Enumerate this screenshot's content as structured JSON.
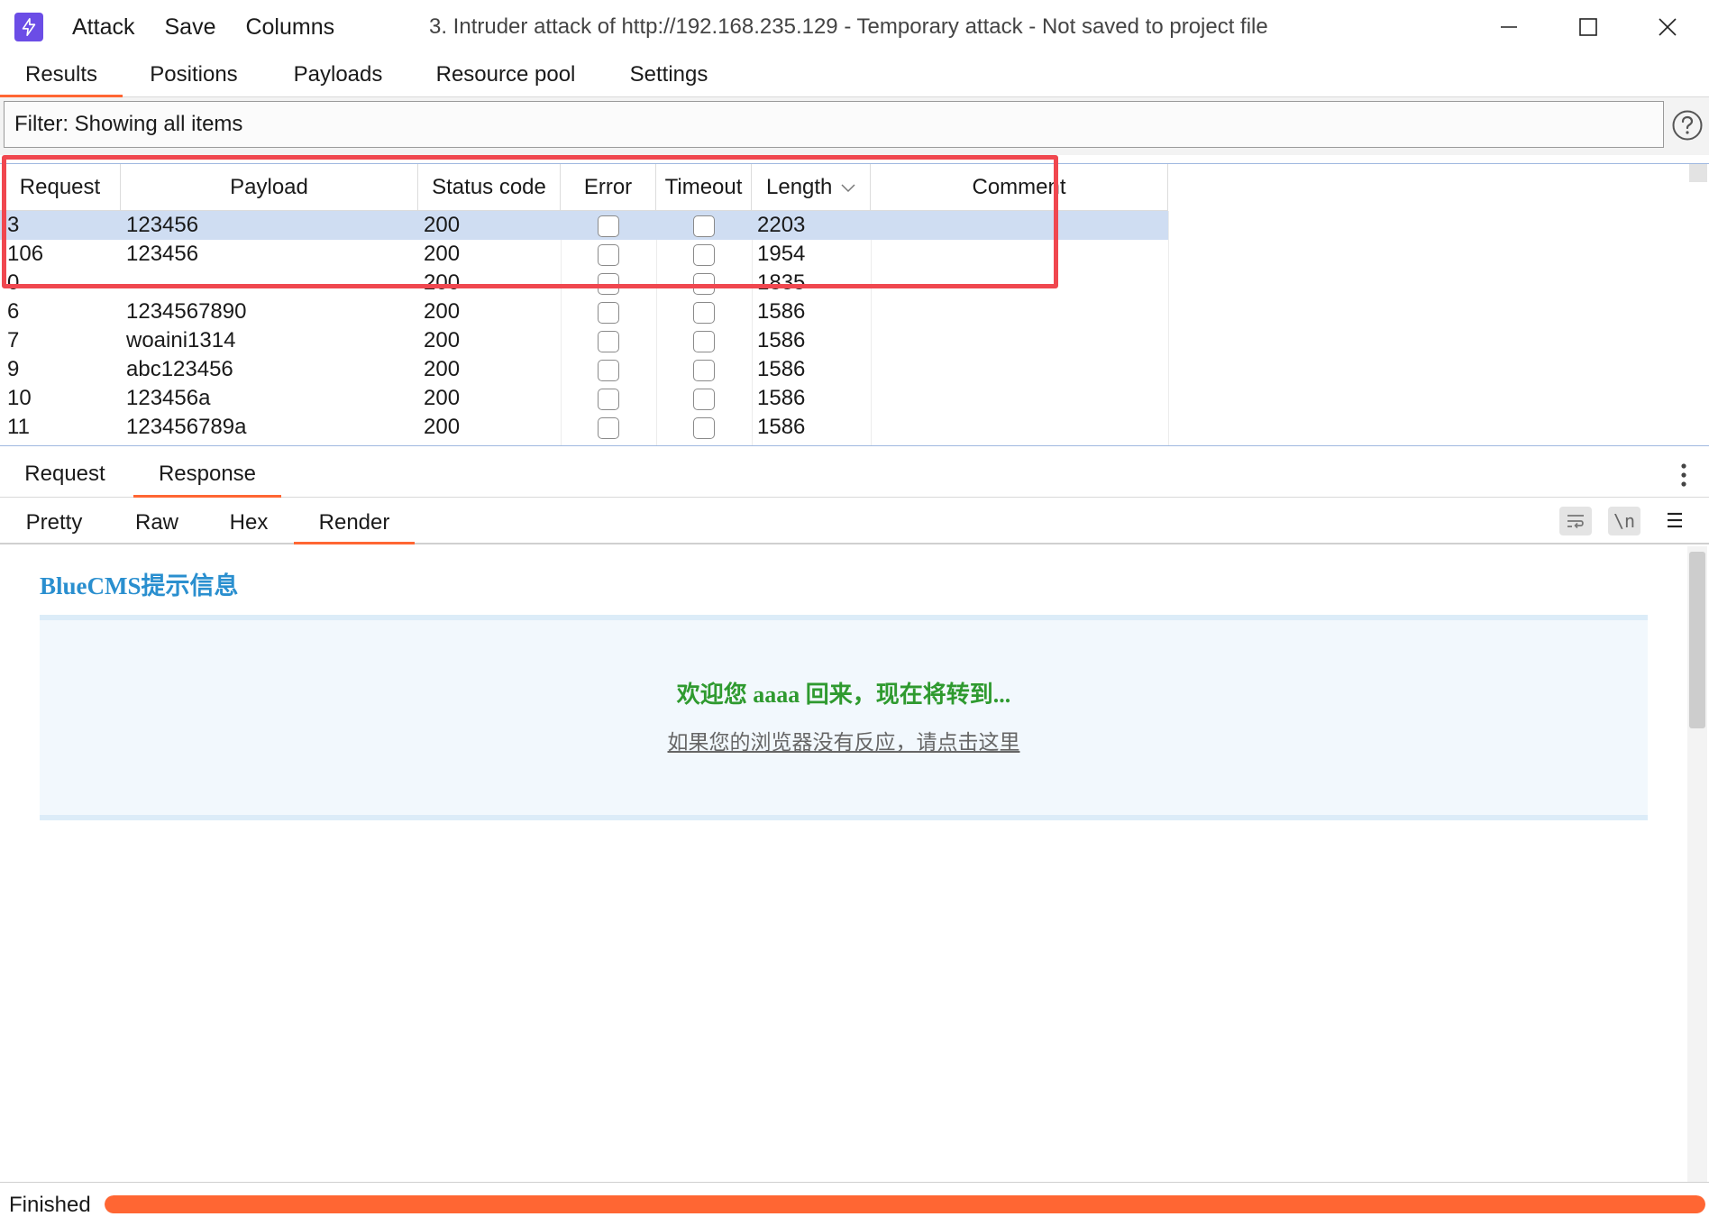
{
  "titlebar": {
    "menu": [
      "Attack",
      "Save",
      "Columns"
    ],
    "title": "3. Intruder attack of http://192.168.235.129 - Temporary attack - Not saved to project file",
    "icons": {
      "app": "lightning-icon",
      "minimize": "minimize-icon",
      "maximize": "maximize-icon",
      "close": "close-icon"
    }
  },
  "main_tabs": [
    {
      "label": "Results",
      "active": true
    },
    {
      "label": "Positions",
      "active": false
    },
    {
      "label": "Payloads",
      "active": false
    },
    {
      "label": "Resource pool",
      "active": false
    },
    {
      "label": "Settings",
      "active": false
    }
  ],
  "filter": {
    "text": "Filter: Showing all items"
  },
  "table": {
    "headers": [
      "Request",
      "Payload",
      "Status code",
      "Error",
      "Timeout",
      "Length",
      "Comment"
    ],
    "sort_column": "Length",
    "rows": [
      {
        "request": "3",
        "payload": "123456",
        "status": "200",
        "error": false,
        "timeout": false,
        "length": "2203",
        "comment": "",
        "selected": true
      },
      {
        "request": "106",
        "payload": "123456",
        "status": "200",
        "error": false,
        "timeout": false,
        "length": "1954",
        "comment": "",
        "selected": false
      },
      {
        "request": "0",
        "payload": "",
        "status": "200",
        "error": false,
        "timeout": false,
        "length": "1835",
        "comment": "",
        "selected": false
      },
      {
        "request": "6",
        "payload": "1234567890",
        "status": "200",
        "error": false,
        "timeout": false,
        "length": "1586",
        "comment": "",
        "selected": false
      },
      {
        "request": "7",
        "payload": "woaini1314",
        "status": "200",
        "error": false,
        "timeout": false,
        "length": "1586",
        "comment": "",
        "selected": false
      },
      {
        "request": "9",
        "payload": "abc123456",
        "status": "200",
        "error": false,
        "timeout": false,
        "length": "1586",
        "comment": "",
        "selected": false
      },
      {
        "request": "10",
        "payload": "123456a",
        "status": "200",
        "error": false,
        "timeout": false,
        "length": "1586",
        "comment": "",
        "selected": false
      },
      {
        "request": "11",
        "payload": "123456789a",
        "status": "200",
        "error": false,
        "timeout": false,
        "length": "1586",
        "comment": "",
        "selected": false
      }
    ]
  },
  "rr_tabs": [
    {
      "label": "Request",
      "active": false
    },
    {
      "label": "Response",
      "active": true
    }
  ],
  "view_tabs": [
    {
      "label": "Pretty",
      "active": false
    },
    {
      "label": "Raw",
      "active": false
    },
    {
      "label": "Hex",
      "active": false
    },
    {
      "label": "Render",
      "active": true
    }
  ],
  "view_tools": {
    "newline": "\\n"
  },
  "render": {
    "title": "BlueCMS提示信息",
    "message": "欢迎您 aaaa 回来，现在将转到...",
    "link": "如果您的浏览器没有反应，请点击这里"
  },
  "status": {
    "text": "Finished",
    "progress_percent": 100
  },
  "colors": {
    "accent": "#ff6633",
    "highlight": "#f0474f",
    "selected_row": "#cfddf2",
    "render_title": "#2a8fcf",
    "render_message": "#2f9a2f"
  }
}
